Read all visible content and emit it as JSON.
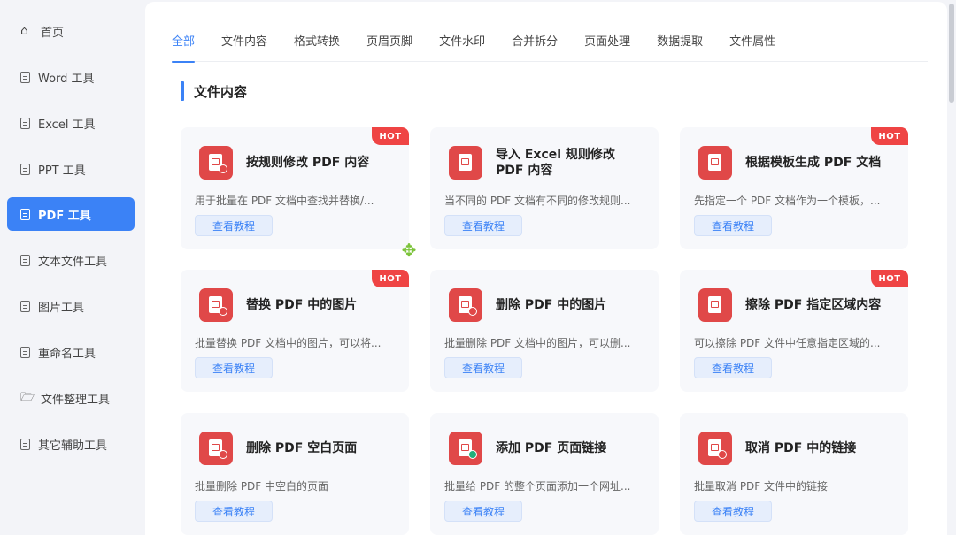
{
  "sidebar": {
    "items": [
      {
        "label": "首页",
        "icon": "home-icon"
      },
      {
        "label": "Word 工具",
        "icon": "doc-icon"
      },
      {
        "label": "Excel 工具",
        "icon": "doc-icon"
      },
      {
        "label": "PPT 工具",
        "icon": "doc-icon"
      },
      {
        "label": "PDF 工具",
        "icon": "doc-icon",
        "active": true
      },
      {
        "label": "文本文件工具",
        "icon": "doc-icon"
      },
      {
        "label": "图片工具",
        "icon": "doc-icon"
      },
      {
        "label": "重命名工具",
        "icon": "doc-icon"
      },
      {
        "label": "文件整理工具",
        "icon": "folder-icon"
      },
      {
        "label": "其它辅助工具",
        "icon": "doc-icon"
      }
    ]
  },
  "tabs": [
    "全部",
    "文件内容",
    "格式转换",
    "页眉页脚",
    "文件水印",
    "合并拆分",
    "页面处理",
    "数据提取",
    "文件属性"
  ],
  "section": {
    "title": "文件内容"
  },
  "cards": [
    {
      "title": "按规则修改 PDF 内容",
      "desc": "用于批量在 PDF 文档中查找并替换/...",
      "button": "查看教程",
      "hot": "HOT",
      "icon": "pdf-edit-icon"
    },
    {
      "title": "导入 Excel 规则修改 PDF 内容",
      "desc": "当不同的 PDF 文档有不同的修改规则...",
      "button": "查看教程",
      "hot": "",
      "icon": "excel-import-icon"
    },
    {
      "title": "根据模板生成 PDF 文档",
      "desc": "先指定一个 PDF 文档作为一个模板，...",
      "button": "查看教程",
      "hot": "HOT",
      "icon": "pdf-template-icon"
    },
    {
      "title": "替换 PDF 中的图片",
      "desc": "批量替换 PDF 文档中的图片，可以将...",
      "button": "查看教程",
      "hot": "HOT",
      "icon": "pdf-replace-image-icon"
    },
    {
      "title": "删除 PDF 中的图片",
      "desc": "批量删除 PDF 文档中的图片，可以删...",
      "button": "查看教程",
      "hot": "",
      "icon": "pdf-delete-image-icon"
    },
    {
      "title": "擦除 PDF 指定区域内容",
      "desc": "可以擦除 PDF 文件中任意指定区域的...",
      "button": "查看教程",
      "hot": "HOT",
      "icon": "pdf-erase-icon"
    },
    {
      "title": "删除 PDF 空白页面",
      "desc": "批量删除 PDF 中空白的页面",
      "button": "查看教程",
      "hot": "",
      "icon": "pdf-delete-blank-icon"
    },
    {
      "title": "添加 PDF 页面链接",
      "desc": "批量给 PDF 的整个页面添加一个网址...",
      "button": "查看教程",
      "hot": "",
      "icon": "pdf-add-link-icon"
    },
    {
      "title": "取消 PDF 中的链接",
      "desc": "批量取消 PDF 文件中的链接",
      "button": "查看教程",
      "hot": "",
      "icon": "pdf-remove-link-icon"
    }
  ],
  "colors": {
    "accent": "#3b82f6",
    "hot": "#ef4444",
    "icon_bg": "#e04848"
  }
}
